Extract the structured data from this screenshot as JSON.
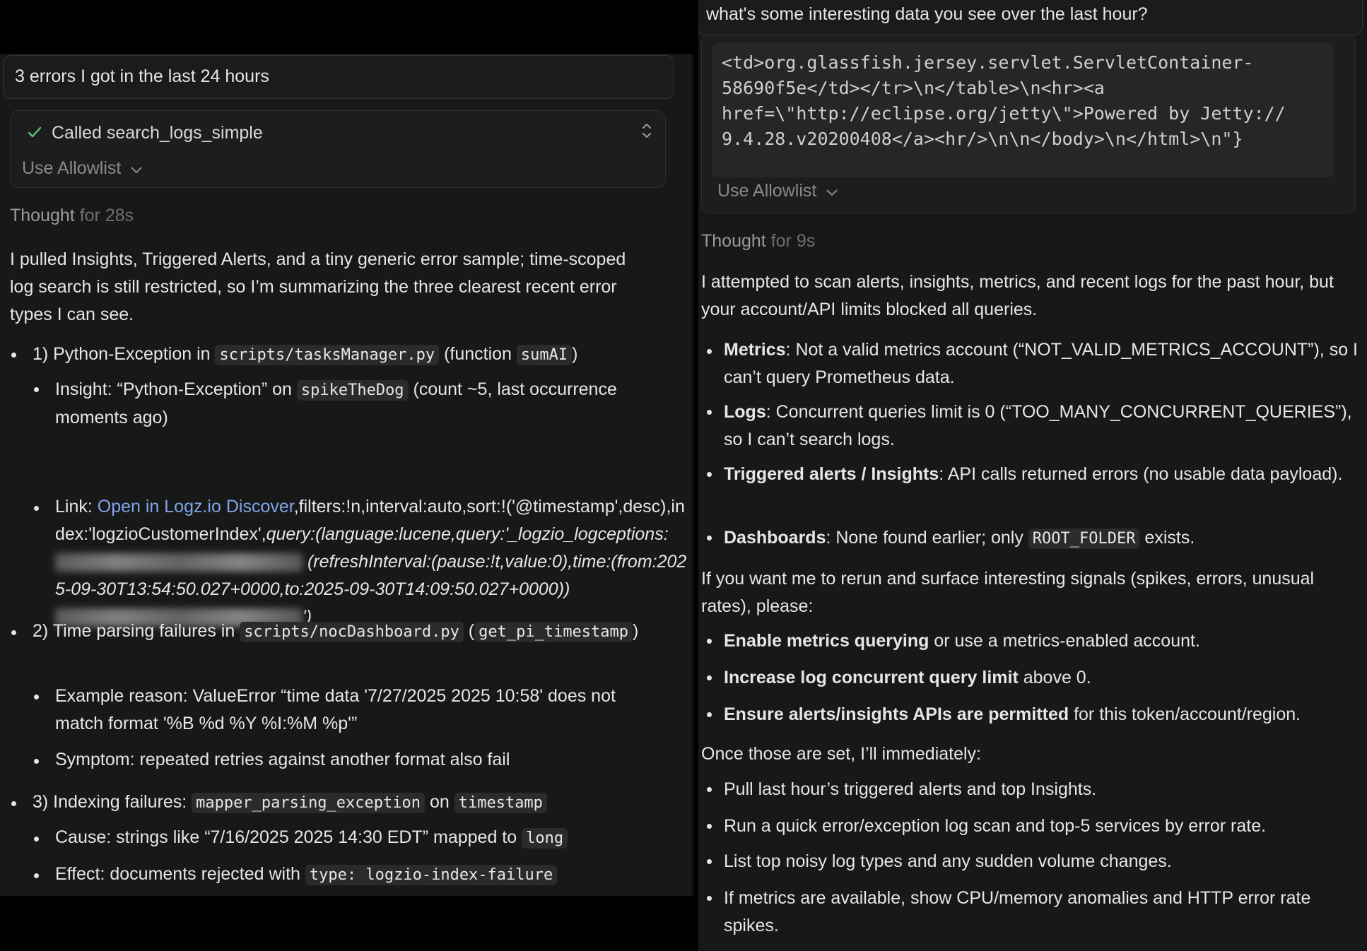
{
  "left": {
    "user_prompt": "3 errors I got in the last 24 hours",
    "tool": {
      "status": "Called search_logs_simple",
      "allowlist": "Use Allowlist"
    },
    "thought": {
      "label": "Thought",
      "duration": "for 28s"
    },
    "intro": "I pulled Insights, Triggered Alerts, and a tiny generic error sample; time-scoped log search is still restricted, so I’m summarizing the three clearest recent error types I can see.",
    "items": [
      {
        "prefix": "1) Python-Exception in ",
        "code1": "scripts/tasksManager.py",
        "mid": " (function ",
        "code2": "sumAI",
        "suffix": ")",
        "subs": {
          "insight_a": "Insight: “Python-Exception” on ",
          "insight_code": "spikeTheDog",
          "insight_b": " (count ~5, last occurrence moments ago)",
          "link_label": "Link: ",
          "link_text": "Open in Logz.io Discover",
          "link_after": ",filters:!n,interval:auto,sort:!('@timestamp',desc),index:'logzioCustomerIndex',",
          "link_query": "query:(language:lucene,query:'_logzio_logceptions:",
          "link_refresh": "(refreshInterval:(pause:!t,value:0),time:(from:2025-09-30T13:54:50.027+0000,to:2025-09-30T14:09:50.027+0000))",
          "link_end": "')"
        }
      },
      {
        "prefix": "2) Time parsing failures in ",
        "code1": "scripts/nocDashboard.py",
        "mid": " (",
        "code2": "get_pi_timestamp",
        "suffix": ")",
        "subs": [
          "Example reason: ValueError “time data '7/27/2025 2025 10:58' does not match format '%B %d %Y %I:%M %p'”",
          "Symptom: repeated retries against another format also fail"
        ]
      },
      {
        "prefix": "3) Indexing failures: ",
        "code1": "mapper_parsing_exception",
        "mid": " on ",
        "code2": "timestamp",
        "subs": {
          "cause_a": "Cause: strings like “7/16/2025 2025 14:30 EDT” mapped to ",
          "cause_code": "long",
          "effect_a": "Effect: documents rejected with ",
          "effect_code": "type: logzio-index-failure"
        }
      }
    ]
  },
  "right": {
    "user_prompt": "what's some interesting data you see over the last hour?",
    "code_block": [
      "<td>org.glassfish.jersey.servlet.ServletContainer-",
      "58690f5e</td></tr>\\n</table>\\n<hr><a",
      "href=\\\"http://eclipse.org/jetty\\\">Powered by Jetty://",
      "9.4.28.v20200408</a><hr/>\\n\\n</body>\\n</html>\\n\"}"
    ],
    "allowlist": "Use Allowlist",
    "thought": {
      "label": "Thought",
      "duration": "for 9s"
    },
    "intro": "I attempted to scan alerts, insights, metrics, and recent logs for the past hour, but your account/API limits blocked all queries.",
    "status_items": [
      {
        "bold": "Metrics",
        "text": ": Not a valid metrics account (“NOT_VALID_METRICS_ACCOUNT”), so I can’t query Prometheus data."
      },
      {
        "bold": "Logs",
        "text": ": Concurrent queries limit is 0 (“TOO_MANY_CONCURRENT_QUERIES”), so I can’t search logs."
      },
      {
        "bold": "Triggered alerts / Insights",
        "text": ": API calls returned errors (no usable data payload)."
      },
      {
        "bold": "Dashboards",
        "text": ": None found earlier; only ",
        "code": "ROOT_FOLDER",
        "after": " exists."
      }
    ],
    "request_intro": "If you want me to rerun and surface interesting signals (spikes, errors, unusual rates), please:",
    "request_items": [
      {
        "bold": "Enable metrics querying",
        "text": " or use a metrics-enabled account."
      },
      {
        "bold": "Increase log concurrent query limit",
        "text": " above 0."
      },
      {
        "bold": "Ensure alerts/insights APIs are permitted",
        "text": " for this token/account/region."
      }
    ],
    "followup_intro": "Once those are set, I’ll immediately:",
    "followup_items": [
      "Pull last hour’s triggered alerts and top Insights.",
      "Run a quick error/exception log scan and top-5 services by error rate.",
      "List top noisy log types and any sudden volume changes.",
      "If metrics are available, show CPU/memory anomalies and HTTP error rate spikes."
    ]
  }
}
